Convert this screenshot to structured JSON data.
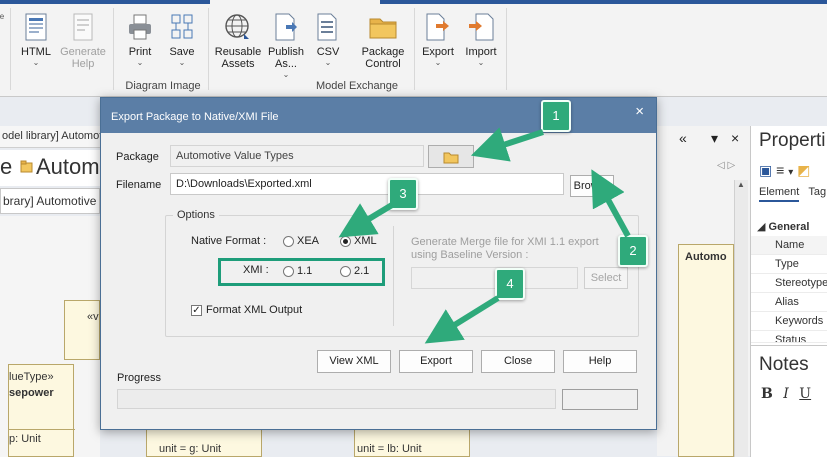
{
  "ribbon": {
    "buttons": [
      {
        "label": "HTML",
        "icon": "html-report-icon"
      },
      {
        "label": "Generate Help",
        "icon": "generate-help-icon"
      },
      {
        "label": "Print",
        "icon": "print-icon"
      },
      {
        "label": "Save",
        "icon": "save-image-icon"
      },
      {
        "label": "Reusable Assets",
        "icon": "reusable-assets-globe-icon"
      },
      {
        "label": "Publish As...",
        "icon": "publish-as-icon"
      },
      {
        "label": "CSV",
        "icon": "csv-icon"
      },
      {
        "label": "Package Control",
        "icon": "package-control-folder-icon"
      },
      {
        "label": "Export",
        "icon": "export-icon"
      },
      {
        "label": "Import",
        "icon": "import-icon"
      }
    ],
    "groups": {
      "diagram_image": "Diagram Image",
      "model_exchange": "Model Exchange"
    }
  },
  "background": {
    "tab_label": "odel library] Automoti",
    "title_prefix": "e",
    "title_text": "Automo",
    "breadcrumb": "brary] Automotive Va",
    "box1_stereotype": "«v",
    "box2_stereotype": "lueType»",
    "box2_name": "sepower",
    "box2_attr": "p: Unit",
    "box3_attr": "unit = g: Unit",
    "box4_attr": "unit = lb: Unit",
    "mid_box_label": "Automo",
    "mid_controls": [
      "«",
      "▾",
      "×"
    ],
    "mid_nav": "◁  ▷"
  },
  "properties": {
    "title": "Properti",
    "tabs": [
      "Element",
      "Tag"
    ],
    "section": "General",
    "rows": [
      "Name",
      "Type",
      "Stereotype",
      "Alias",
      "Keywords",
      "Status"
    ]
  },
  "notes": {
    "title": "Notes",
    "tools": [
      "B",
      "I",
      "U"
    ]
  },
  "dialog": {
    "title": "Export Package to Native/XMI File",
    "close": "×",
    "package_label": "Package",
    "package_value": "Automotive Value Types",
    "filename_label": "Filename",
    "filename_value": "D:\\Downloads\\Exported.xml",
    "browse": "Browse",
    "options_legend": "Options",
    "native_format_label": "Native Format :",
    "xea": "XEA",
    "xml": "XML",
    "xmi_label": "XMI :",
    "xmi_11": "1.1",
    "xmi_21": "2.1",
    "format_xml_output": "Format XML Output",
    "merge_text": "Generate Merge file for XMI 1.1 export using Baseline Version :",
    "select": "Select",
    "view_xml": "View XML",
    "export": "Export",
    "close_button": "Close",
    "help": "Help",
    "progress_label": "Progress"
  },
  "callouts": [
    "1",
    "2",
    "3",
    "4"
  ],
  "colors": {
    "dialog_titlebar": "#5b7ea6",
    "callout": "#2faa7b",
    "highlight": "#1e9d7a",
    "ribbon_accent": "#2b579a"
  }
}
